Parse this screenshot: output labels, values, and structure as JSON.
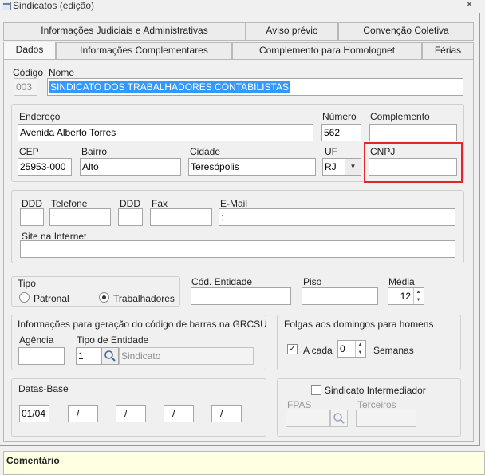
{
  "window": {
    "title": "Sindicatos (edição)",
    "close": "×"
  },
  "tabs_row1": [
    "Informações Judiciais e Administrativas",
    "Aviso prévio",
    "Convenção Coletiva"
  ],
  "tabs_row2": [
    "Dados",
    "Informações Complementares",
    "Complemento para Homolognet",
    "Férias"
  ],
  "ident": {
    "codigo_label": "Código",
    "codigo_value": "003",
    "nome_label": "Nome",
    "nome_value": "SINDICATO DOS TRABALHADORES CONTABILISTAS"
  },
  "address": {
    "endereco_label": "Endereço",
    "endereco_value": "Avenida Alberto Torres",
    "numero_label": "Número",
    "numero_value": "562",
    "complemento_label": "Complemento",
    "complemento_value": "",
    "cep_label": "CEP",
    "cep_value": "25953-000",
    "bairro_label": "Bairro",
    "bairro_value": "Alto",
    "cidade_label": "Cidade",
    "cidade_value": "Teresópolis",
    "uf_label": "UF",
    "uf_value": "RJ",
    "cnpj_label": "CNPJ",
    "cnpj_value": ""
  },
  "contact": {
    "ddd_label": "DDD",
    "telefone_label": "Telefone",
    "telefone_value": ":",
    "ddd2_label": "DDD",
    "fax_label": "Fax",
    "email_label": "E-Mail",
    "email_value": ":",
    "site_label": "Site na Internet"
  },
  "tipo": {
    "label": "Tipo",
    "opt1": "Patronal",
    "opt2": "Trabalhadores"
  },
  "entidade": {
    "cod_label": "Cód. Entidade",
    "piso_label": "Piso",
    "media_label": "Média",
    "media_value": "12"
  },
  "grcsu": {
    "label": "Informações para geração do código de barras na GRCSU",
    "agencia_label": "Agência",
    "tipo_ent_label": "Tipo de Entidade",
    "tipo_ent_value": "1",
    "tipo_ent_desc": "Sindicato"
  },
  "folgas": {
    "label": "Folgas aos domingos para homens",
    "acada": "A cada",
    "value": "0",
    "semanas": "Semanas",
    "checkmark": "✓"
  },
  "datas": {
    "label": "Datas-Base",
    "d1": "01/04",
    "d2": "/",
    "d3": "/",
    "d4": "/",
    "d5": "/"
  },
  "intermed": {
    "label": "Sindicato Intermediador",
    "fpas_label": "FPAS",
    "terceiros_label": "Terceiros"
  },
  "comentario": {
    "label": "Comentário"
  }
}
